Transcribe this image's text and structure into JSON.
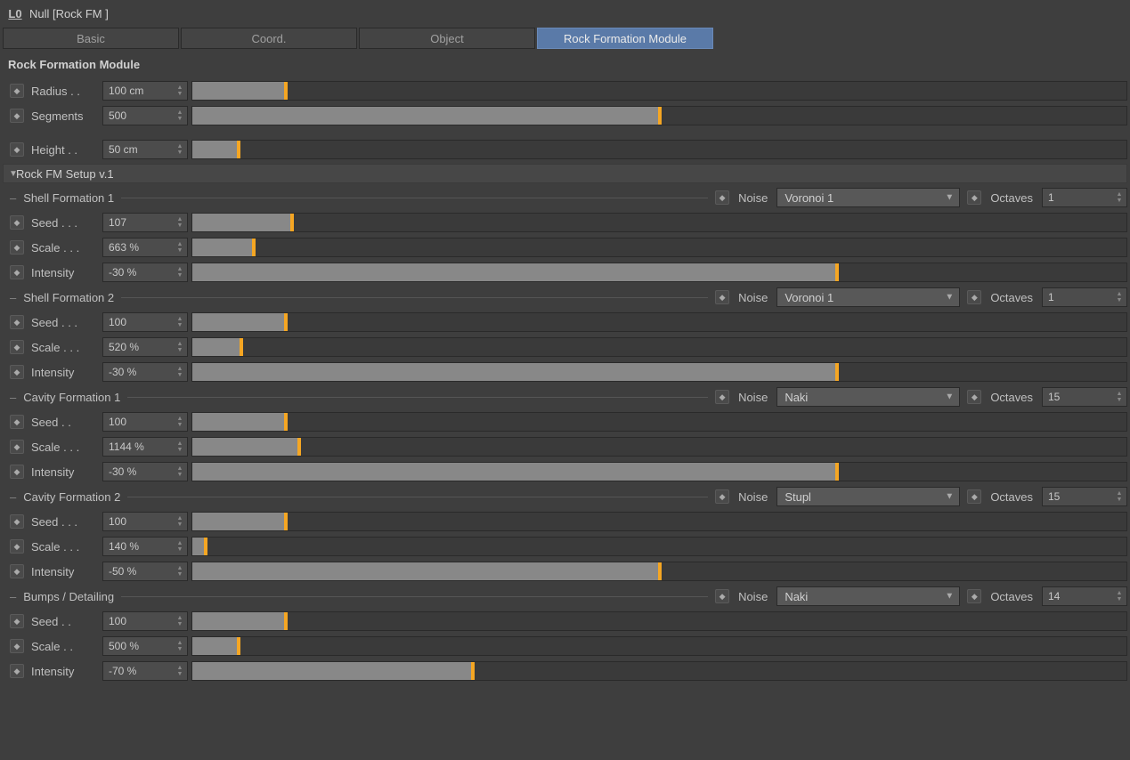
{
  "header": {
    "title": "Null [Rock FM ]"
  },
  "tabs": [
    {
      "label": "Basic"
    },
    {
      "label": "Coord."
    },
    {
      "label": "Object"
    },
    {
      "label": "Rock Formation Module",
      "active": true
    }
  ],
  "section_title": "Rock Formation Module",
  "top_params": [
    {
      "label": "Radius . .",
      "value": "100 cm",
      "pct": 10
    },
    {
      "label": "Segments",
      "value": "500",
      "pct": 50
    }
  ],
  "height_param": {
    "label": "Height . .",
    "value": "50 cm",
    "pct": 5
  },
  "setup_title": "Rock FM Setup v.1",
  "noise_label": "Noise",
  "octaves_label": "Octaves",
  "formations": [
    {
      "name": "Shell Formation 1",
      "noise": "Voronoi 1",
      "octaves": "1",
      "params": [
        {
          "label": "Seed . . .",
          "value": "107",
          "pct": 10.7
        },
        {
          "label": "Scale . . .",
          "value": "663 %",
          "pct": 6.6
        },
        {
          "label": "Intensity",
          "value": "-30 %",
          "pct": 69
        }
      ]
    },
    {
      "name": "Shell Formation 2",
      "noise": "Voronoi 1",
      "octaves": "1",
      "params": [
        {
          "label": "Seed  . . .",
          "value": "100",
          "pct": 10
        },
        {
          "label": "Scale  . . .",
          "value": "520 %",
          "pct": 5.2
        },
        {
          "label": "Intensity",
          "value": "-30 %",
          "pct": 69
        }
      ]
    },
    {
      "name": "Cavity Formation 1",
      "noise": "Naki",
      "octaves": "15",
      "params": [
        {
          "label": "Seed  . .",
          "value": "100",
          "pct": 10
        },
        {
          "label": "Scale . . .",
          "value": "1144 %",
          "pct": 11.4
        },
        {
          "label": "Intensity",
          "value": "-30 %",
          "pct": 69
        }
      ]
    },
    {
      "name": "Cavity Formation 2",
      "noise": "Stupl",
      "octaves": "15",
      "params": [
        {
          "label": "Seed  . . .",
          "value": "100",
          "pct": 10
        },
        {
          "label": "Scale  . . .",
          "value": "140 %",
          "pct": 1.4
        },
        {
          "label": "Intensity",
          "value": "-50 %",
          "pct": 50
        }
      ]
    },
    {
      "name": "Bumps / Detailing",
      "noise": "Naki",
      "octaves": "14",
      "params": [
        {
          "label": "Seed  . .",
          "value": "100",
          "pct": 10
        },
        {
          "label": "Scale  . .",
          "value": "500 %",
          "pct": 5
        },
        {
          "label": "Intensity",
          "value": "-70 %",
          "pct": 30
        }
      ]
    }
  ]
}
